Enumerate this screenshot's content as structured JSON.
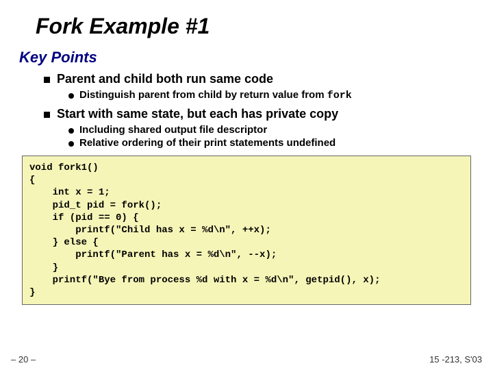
{
  "title": "Fork Example #1",
  "subtitle": "Key Points",
  "bullets": [
    {
      "text": "Parent and child both run same code",
      "sub": [
        {
          "pre": "Distinguish parent from child by return value from ",
          "code": "fork"
        }
      ]
    },
    {
      "text": "Start with same state, but each has private copy",
      "sub": [
        {
          "pre": "Including shared output file descriptor",
          "code": ""
        },
        {
          "pre": "Relative ordering of their print statements undefined",
          "code": ""
        }
      ]
    }
  ],
  "code": "void fork1()\n{\n    int x = 1;\n    pid_t pid = fork();\n    if (pid == 0) {\n        printf(\"Child has x = %d\\n\", ++x);\n    } else {\n        printf(\"Parent has x = %d\\n\", --x);\n    }\n    printf(\"Bye from process %d with x = %d\\n\", getpid(), x);\n}",
  "footer_left": "– 20 –",
  "footer_right": "15 -213, S'03"
}
